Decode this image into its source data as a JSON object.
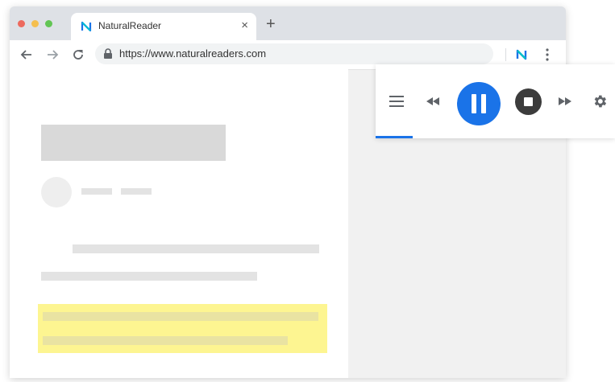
{
  "browser": {
    "tab": {
      "title": "NaturalReader",
      "close_label": "×",
      "favicon": "naturalreader-logo-icon"
    },
    "new_tab_label": "+",
    "address_bar": {
      "url": "https://www.naturalreaders.com"
    },
    "icons": [
      "back-arrow-icon",
      "forward-arrow-icon",
      "reload-icon",
      "lock-icon",
      "naturalreader-extension-icon",
      "more-vert-icon"
    ]
  },
  "player": {
    "icons": [
      "menu-icon",
      "rewind-icon",
      "pause-icon",
      "stop-icon",
      "fast-forward-icon",
      "gear-icon"
    ],
    "state": "playing",
    "accent_color": "#1a73e8",
    "highlight_color": "#fdf591"
  }
}
